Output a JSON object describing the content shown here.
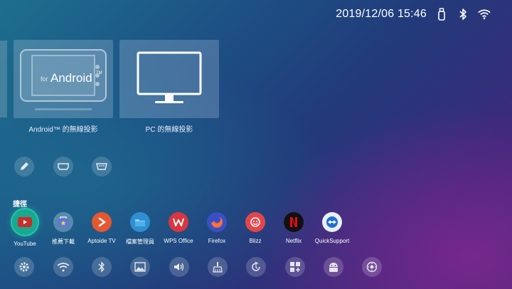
{
  "status_bar": {
    "datetime": "2019/12/06 15:46",
    "icons": [
      "usb-icon",
      "bluetooth-icon",
      "wifi-icon"
    ]
  },
  "cast": {
    "android": {
      "label": "Android™ 的無線投影",
      "card_text": "Android",
      "card_prefix": "for",
      "tm": "TM"
    },
    "pc": {
      "label": "PC 的無線投影"
    }
  },
  "input_sources": [
    "pen-icon",
    "hdmi-icon",
    "vga-icon"
  ],
  "shortcuts": {
    "title": "捷徑",
    "apps": [
      {
        "label": "YouTube",
        "icon": "youtube-icon",
        "color": "#c4302b"
      },
      {
        "label": "推薦下載",
        "icon": "store-icon",
        "color": "#5b7bd6"
      },
      {
        "label": "Aptoide TV",
        "icon": "aptoide-icon",
        "color": "#e5572f"
      },
      {
        "label": "檔案管理員",
        "icon": "file-manager-icon",
        "color": "#2f8fd1"
      },
      {
        "label": "WPS Office",
        "icon": "wps-icon",
        "color": "#d9363e"
      },
      {
        "label": "Firefox",
        "icon": "firefox-icon",
        "color": "#ff7139"
      },
      {
        "label": "Blizz",
        "icon": "blizz-icon",
        "color": "#e4454b"
      },
      {
        "label": "Netflix",
        "icon": "netflix-icon",
        "color": "#111111"
      },
      {
        "label": "QuickSupport",
        "icon": "quicksupport-icon",
        "color": "#1d6fd1"
      }
    ]
  },
  "settings_row": [
    "settings-icon",
    "wifi-icon",
    "bluetooth-icon",
    "gallery-icon",
    "volume-icon",
    "cleaner-icon",
    "update-icon",
    "apps-icon",
    "android-icon",
    "remote-icon"
  ]
}
